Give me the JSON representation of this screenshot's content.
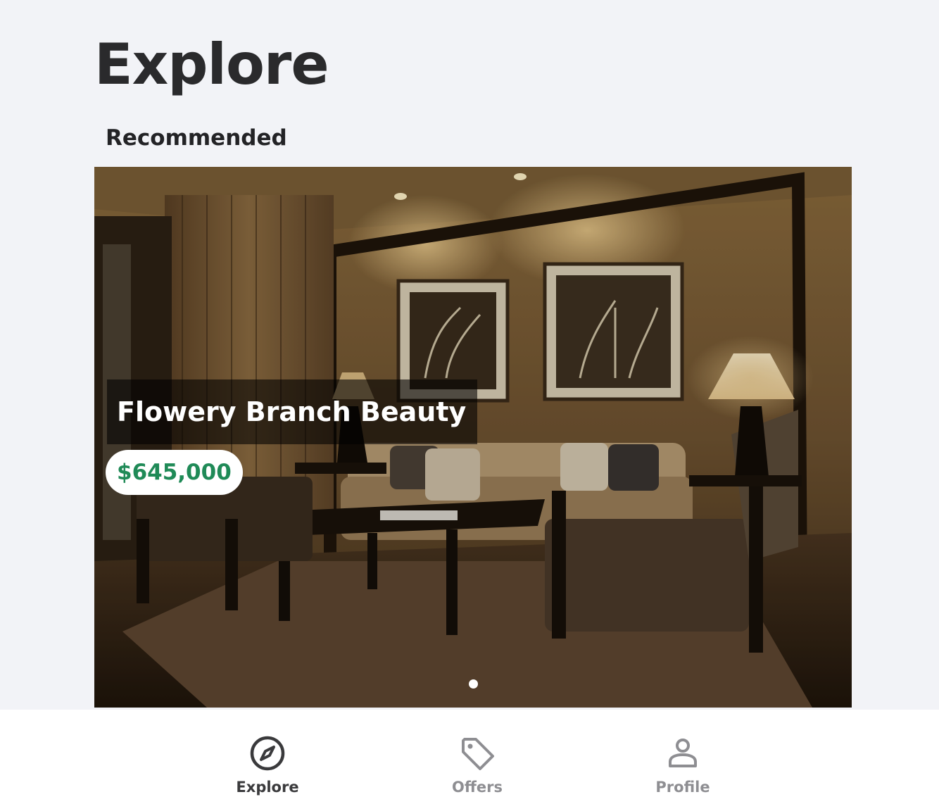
{
  "header": {
    "title": "Explore"
  },
  "recommended": {
    "section_title": "Recommended",
    "listing": {
      "name": "Flowery Branch Beauty",
      "price": "$645,000"
    },
    "slide_count": 1,
    "active_slide": 1
  },
  "tabbar": {
    "tabs": [
      {
        "label": "Explore",
        "icon": "compass-icon",
        "active": true
      },
      {
        "label": "Offers",
        "icon": "tag-icon",
        "active": false
      },
      {
        "label": "Profile",
        "icon": "person-icon",
        "active": false
      }
    ]
  },
  "colors": {
    "background": "#f2f3f7",
    "price_green": "#1f8a57",
    "active_tab": "#3a3a3c",
    "inactive_tab": "#8e8e92"
  }
}
